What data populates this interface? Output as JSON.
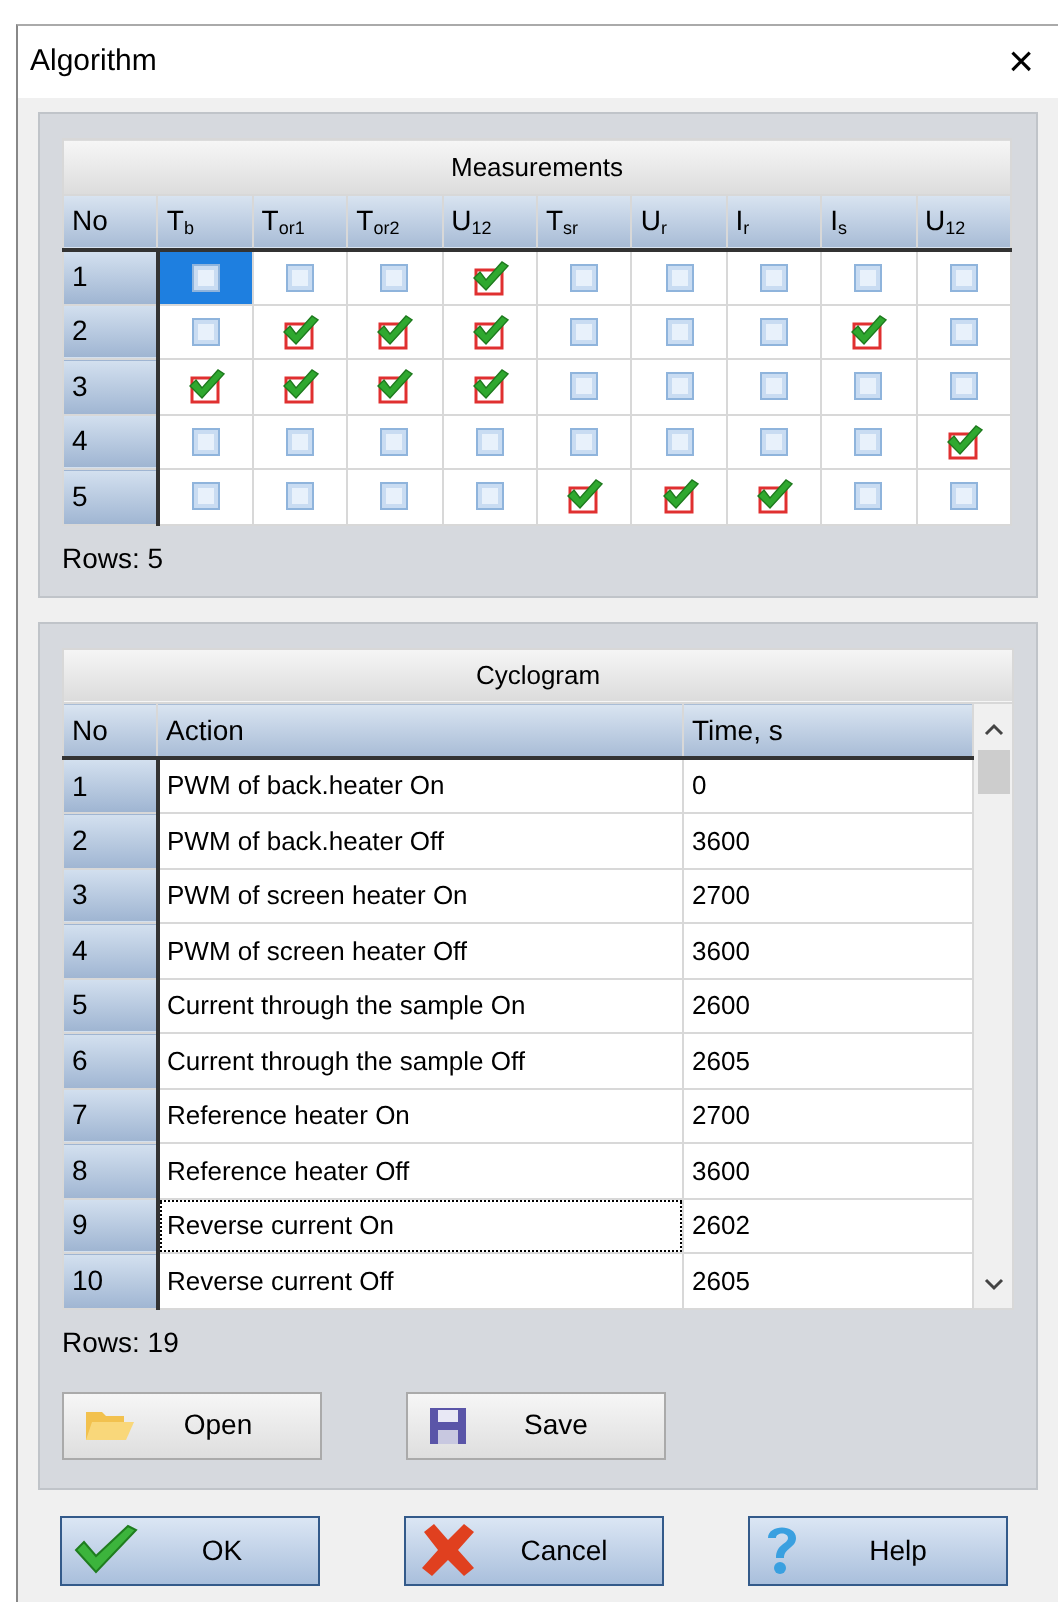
{
  "window": {
    "title": "Algorithm",
    "close": "×"
  },
  "measurements": {
    "title": "Measurements",
    "columns": [
      "No",
      "T$_{b}$",
      "T$_{or1}$",
      "T$_{or2}$",
      "U$_{12}$",
      "T$_{sr}$",
      "U$_{r}$",
      "I$_{r}$",
      "I$_{s}$",
      "U$_{12}$"
    ],
    "rows": [
      {
        "no": "1",
        "cells": [
          {
            "checked": false,
            "selected": true
          },
          {
            "checked": false,
            "selected": false
          },
          {
            "checked": false,
            "selected": false
          },
          {
            "checked": true,
            "selected": false
          },
          {
            "checked": false,
            "selected": false
          },
          {
            "checked": false,
            "selected": false
          },
          {
            "checked": false,
            "selected": false
          },
          {
            "checked": false,
            "selected": false
          },
          {
            "checked": false,
            "selected": false
          }
        ]
      },
      {
        "no": "2",
        "cells": [
          {
            "checked": false,
            "selected": false
          },
          {
            "checked": true,
            "selected": false
          },
          {
            "checked": true,
            "selected": false
          },
          {
            "checked": true,
            "selected": false
          },
          {
            "checked": false,
            "selected": false
          },
          {
            "checked": false,
            "selected": false
          },
          {
            "checked": false,
            "selected": false
          },
          {
            "checked": true,
            "selected": false
          },
          {
            "checked": false,
            "selected": false
          }
        ]
      },
      {
        "no": "3",
        "cells": [
          {
            "checked": true,
            "selected": false
          },
          {
            "checked": true,
            "selected": false
          },
          {
            "checked": true,
            "selected": false
          },
          {
            "checked": true,
            "selected": false
          },
          {
            "checked": false,
            "selected": false
          },
          {
            "checked": false,
            "selected": false
          },
          {
            "checked": false,
            "selected": false
          },
          {
            "checked": false,
            "selected": false
          },
          {
            "checked": false,
            "selected": false
          }
        ]
      },
      {
        "no": "4",
        "cells": [
          {
            "checked": false,
            "selected": false
          },
          {
            "checked": false,
            "selected": false
          },
          {
            "checked": false,
            "selected": false
          },
          {
            "checked": false,
            "selected": false
          },
          {
            "checked": false,
            "selected": false
          },
          {
            "checked": false,
            "selected": false
          },
          {
            "checked": false,
            "selected": false
          },
          {
            "checked": false,
            "selected": false
          },
          {
            "checked": true,
            "selected": false
          }
        ]
      },
      {
        "no": "5",
        "cells": [
          {
            "checked": false,
            "selected": false
          },
          {
            "checked": false,
            "selected": false
          },
          {
            "checked": false,
            "selected": false
          },
          {
            "checked": false,
            "selected": false
          },
          {
            "checked": true,
            "selected": false
          },
          {
            "checked": true,
            "selected": false
          },
          {
            "checked": true,
            "selected": false
          },
          {
            "checked": false,
            "selected": false
          },
          {
            "checked": false,
            "selected": false
          }
        ]
      }
    ],
    "row_count": "Rows: 5"
  },
  "cyclogram": {
    "title": "Cyclogram",
    "columns": [
      "No",
      "Action",
      "Time, s"
    ],
    "rows": [
      {
        "no": "1",
        "action": "PWM of back.heater On",
        "time": "0",
        "selected": false
      },
      {
        "no": "2",
        "action": "PWM of back.heater Off",
        "time": "3600",
        "selected": false
      },
      {
        "no": "3",
        "action": "PWM of screen heater On",
        "time": "2700",
        "selected": false
      },
      {
        "no": "4",
        "action": "PWM of screen heater Off",
        "time": "3600",
        "selected": false
      },
      {
        "no": "5",
        "action": "Current through the sample On",
        "time": "2600",
        "selected": false
      },
      {
        "no": "6",
        "action": "Current through the sample Off",
        "time": "2605",
        "selected": false
      },
      {
        "no": "7",
        "action": "Reference heater On",
        "time": "2700",
        "selected": false
      },
      {
        "no": "8",
        "action": "Reference heater Off",
        "time": "3600",
        "selected": false
      },
      {
        "no": "9",
        "action": "Reverse current On",
        "time": "2602",
        "selected": true
      },
      {
        "no": "10",
        "action": "Reverse current Off",
        "time": "2605",
        "selected": false
      }
    ],
    "row_count": "Rows: 19"
  },
  "file_buttons": [
    {
      "kind": "open",
      "label": "Open"
    },
    {
      "kind": "save",
      "label": "Save"
    }
  ],
  "buttons": [
    {
      "kind": "ok",
      "label": "OK"
    },
    {
      "kind": "cancel",
      "label": "Cancel"
    },
    {
      "kind": "help",
      "label": "Help"
    }
  ]
}
